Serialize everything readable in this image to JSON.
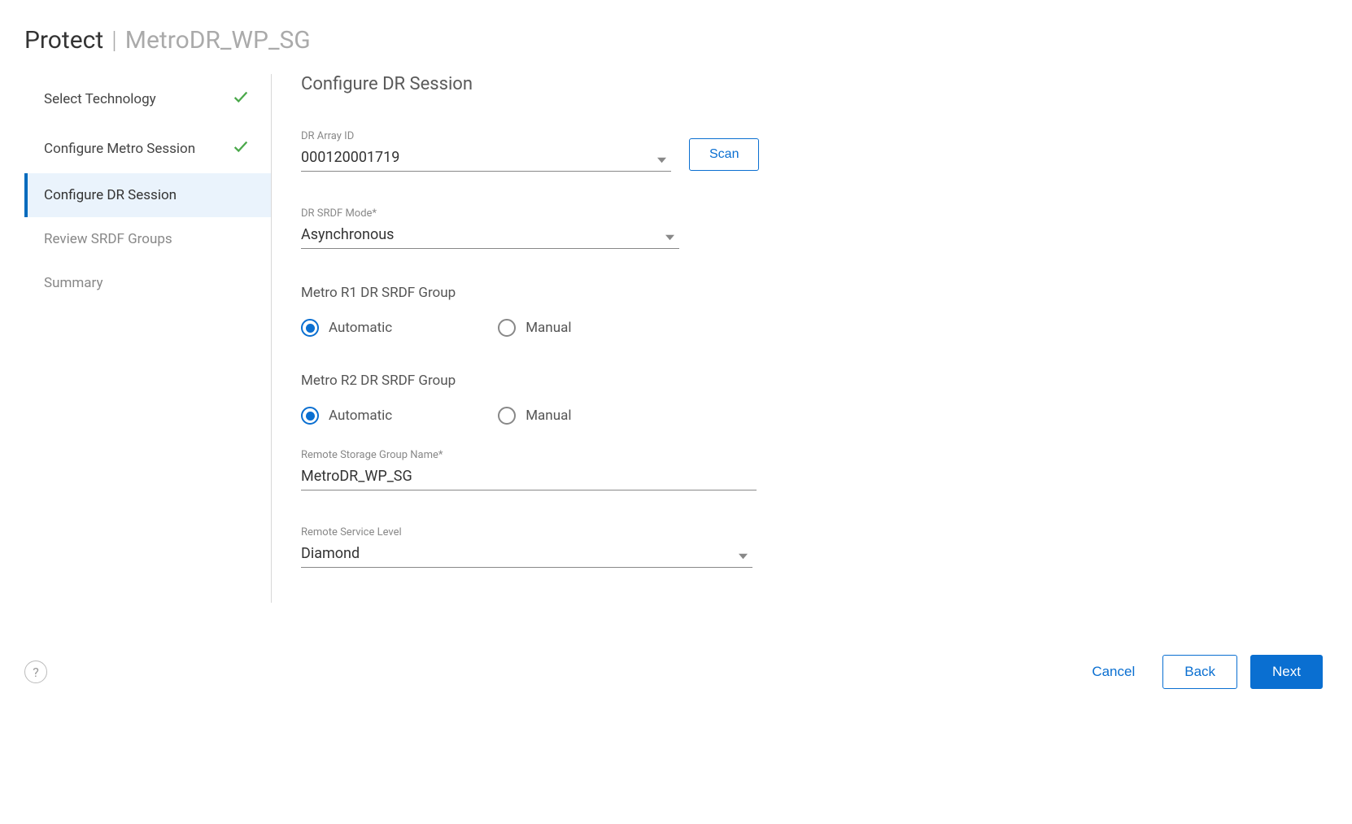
{
  "header": {
    "main": "Protect",
    "separator": "|",
    "sub": "MetroDR_WP_SG"
  },
  "wizard": {
    "steps": [
      {
        "label": "Select Technology",
        "state": "completed"
      },
      {
        "label": "Configure Metro Session",
        "state": "completed"
      },
      {
        "label": "Configure DR Session",
        "state": "active"
      },
      {
        "label": "Review SRDF Groups",
        "state": "pending"
      },
      {
        "label": "Summary",
        "state": "pending"
      }
    ]
  },
  "content": {
    "title": "Configure DR Session",
    "dr_array_id": {
      "label": "DR Array ID",
      "value": "000120001719"
    },
    "scan_button": "Scan",
    "dr_srdf_mode": {
      "label": "DR SRDF Mode*",
      "value": "Asynchronous"
    },
    "r1_group": {
      "heading": "Metro R1 DR SRDF Group",
      "options": {
        "automatic": "Automatic",
        "manual": "Manual"
      },
      "selected": "automatic"
    },
    "r2_group": {
      "heading": "Metro R2 DR SRDF Group",
      "options": {
        "automatic": "Automatic",
        "manual": "Manual"
      },
      "selected": "automatic"
    },
    "remote_sg_name": {
      "label": "Remote Storage Group Name*",
      "value": "MetroDR_WP_SG"
    },
    "remote_service_level": {
      "label": "Remote Service Level",
      "value": "Diamond"
    }
  },
  "footer": {
    "help_glyph": "?",
    "cancel": "Cancel",
    "back": "Back",
    "next": "Next"
  }
}
